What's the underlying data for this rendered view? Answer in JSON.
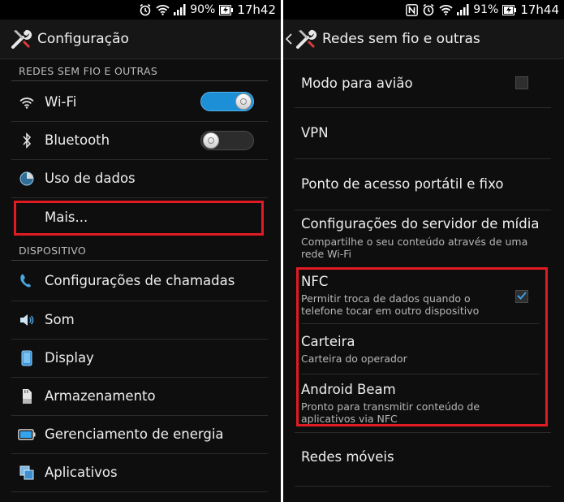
{
  "left": {
    "status": {
      "battery": "90%",
      "time": "17h42"
    },
    "title": "Configuração",
    "section_wireless": "REDES SEM FIO E OUTRAS",
    "section_device": "DISPOSITIVO",
    "items": [
      {
        "label": "Wi-Fi",
        "icon": "wifi-icon",
        "toggle": "on"
      },
      {
        "label": "Bluetooth",
        "icon": "bluetooth-icon",
        "toggle": "off"
      },
      {
        "label": "Uso de dados",
        "icon": "data-usage-icon"
      },
      {
        "label": "Mais..."
      },
      {
        "label": "Configurações de chamadas",
        "icon": "phone-icon"
      },
      {
        "label": "Som",
        "icon": "speaker-icon"
      },
      {
        "label": "Display",
        "icon": "display-icon"
      },
      {
        "label": "Armazenamento",
        "icon": "storage-icon"
      },
      {
        "label": "Gerenciamento de energia",
        "icon": "battery-icon"
      },
      {
        "label": "Aplicativos",
        "icon": "apps-icon"
      }
    ]
  },
  "right": {
    "status": {
      "battery": "91%",
      "time": "17h44"
    },
    "title": "Redes sem fio e outras",
    "items": [
      {
        "title": "Modo para avião",
        "checkbox": false
      },
      {
        "title": "VPN"
      },
      {
        "title": "Ponto de acesso portátil e fixo"
      },
      {
        "title": "Configurações do servidor de mídia",
        "subtitle": "Compartilhe o seu conteúdo através de uma rede Wi-Fi"
      },
      {
        "title": "NFC",
        "subtitle": "Permitir troca de dados quando o telefone tocar em outro dispositivo",
        "checkbox": true
      },
      {
        "title": "Carteira",
        "subtitle": "Carteira do operador"
      },
      {
        "title": "Android Beam",
        "subtitle": "Pronto para transmitir conteúdo de aplicativos via NFC"
      },
      {
        "title": "Redes móveis"
      }
    ]
  },
  "colors": {
    "highlight": "#e11b23",
    "toggle_on": "#1c8fd6",
    "check": "#3aa0e6"
  }
}
